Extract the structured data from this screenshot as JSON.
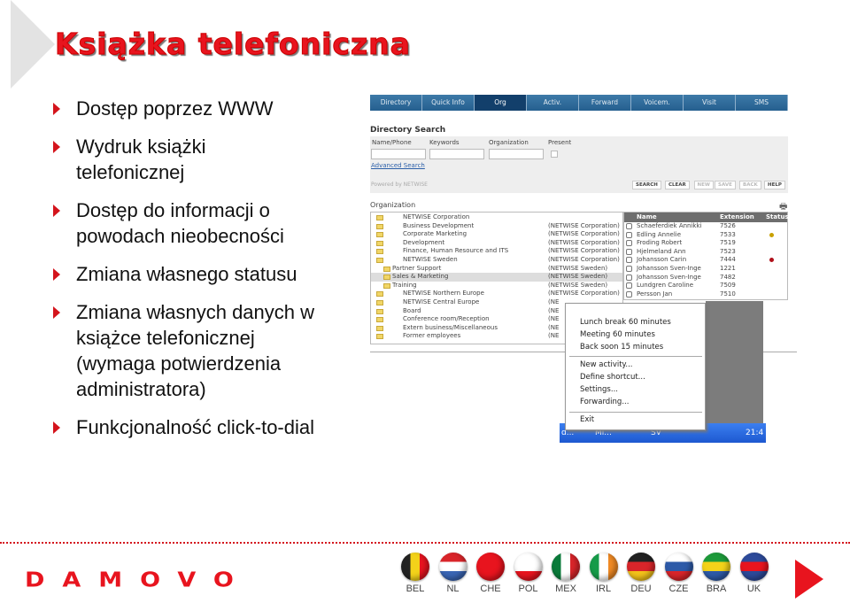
{
  "title": "Książka telefoniczna",
  "bullets": [
    "Dostęp poprzez WWW",
    "Wydruk książki telefonicznej",
    "Dostęp do informacji o powodach nieobecności",
    "Zmiana własnego statusu",
    "Zmiana własnych danych w książce telefonicznej (wymaga potwierdzenia administratora)",
    "Funkcjonalność click-to-dial"
  ],
  "app": {
    "tabs": [
      "Directory",
      "Quick Info",
      "Org",
      "Activ.",
      "Forward",
      "Voicem.",
      "Visit",
      "SMS"
    ],
    "active_tab": "Org",
    "search_title": "Directory Search",
    "fields": [
      "Name/Phone",
      "Keywords",
      "Organization"
    ],
    "present_label": "Present",
    "advanced_link": "Advanced Search",
    "powered": "Powered by NETWISE",
    "buttons": [
      "SEARCH",
      "CLEAR",
      "NEW",
      "SAVE",
      "BACK",
      "HELP"
    ],
    "org_label": "Organization",
    "tree": [
      {
        "name": "NETWISE Corporation",
        "parent": ""
      },
      {
        "name": "Business Development",
        "parent": "(NETWISE Corporation)"
      },
      {
        "name": "Corporate Marketing",
        "parent": "(NETWISE Corporation)"
      },
      {
        "name": "Development",
        "parent": "(NETWISE Corporation)"
      },
      {
        "name": "Finance, Human Resource and ITS",
        "parent": "(NETWISE Corporation)"
      },
      {
        "name": "NETWISE Sweden",
        "parent": "(NETWISE Corporation)"
      },
      {
        "name": "Partner Support",
        "parent": "(NETWISE Sweden)"
      },
      {
        "name": "Sales & Marketing",
        "parent": "(NETWISE Sweden)"
      },
      {
        "name": "Training",
        "parent": "(NETWISE Sweden)"
      },
      {
        "name": "NETWISE Northern Europe",
        "parent": "(NETWISE Corporation)"
      },
      {
        "name": "NETWISE Central Europe",
        "parent": "(NE"
      },
      {
        "name": "Board",
        "parent": "(NE"
      },
      {
        "name": "Conference room/Reception",
        "parent": "(NE"
      },
      {
        "name": "Extern business/Miscellaneous",
        "parent": "(NE"
      },
      {
        "name": "Former employees",
        "parent": "(NE"
      }
    ],
    "people_headers": [
      "Name",
      "Extension",
      "Status"
    ],
    "people": [
      {
        "name": "Schaeferdiek Annikki",
        "ext": "7526",
        "status": ""
      },
      {
        "name": "Edling Annelie",
        "ext": "7533",
        "status": "#c8a000"
      },
      {
        "name": "Froding Robert",
        "ext": "7519",
        "status": ""
      },
      {
        "name": "Hjelmeland Ann",
        "ext": "7523",
        "status": ""
      },
      {
        "name": "Johansson Carin",
        "ext": "7444",
        "status": "#b0101a"
      },
      {
        "name": "Johansson Sven-Inge",
        "ext": "1221",
        "status": ""
      },
      {
        "name": "Johansson Sven-Inge",
        "ext": "7482",
        "status": ""
      },
      {
        "name": "Lundgren Caroline",
        "ext": "7509",
        "status": ""
      },
      {
        "name": "Persson Jan",
        "ext": "7510",
        "status": ""
      }
    ],
    "menu": [
      "Lunch break 60 minutes",
      "Meeting 60 minutes",
      "Back soon 15 minutes",
      "New activity...",
      "Define shortcut...",
      "Settings...",
      "Forwarding...",
      "Exit"
    ],
    "taskbar": {
      "item1": "d...",
      "item2": "Mi...",
      "lang": "SV",
      "clock": "21:4"
    }
  },
  "logo": "DAMOVO",
  "flags": [
    {
      "code": "BEL",
      "colors": [
        "#222",
        "#f3d21a",
        "#e8141e"
      ]
    },
    {
      "code": "NL",
      "colors": [
        "#d9252a",
        "#fff",
        "#3a66b5"
      ]
    },
    {
      "code": "CHE",
      "colors": [
        "#e8141e",
        "#e8141e",
        "#e8141e"
      ]
    },
    {
      "code": "POL",
      "colors": [
        "#fff",
        "#fff",
        "#e8141e"
      ]
    },
    {
      "code": "MEX",
      "colors": [
        "#0a7a3a",
        "#fff",
        "#d9252a"
      ]
    },
    {
      "code": "IRL",
      "colors": [
        "#169b49",
        "#fff",
        "#f08a24"
      ]
    },
    {
      "code": "DEU",
      "colors": [
        "#222",
        "#d9252a",
        "#f3c21a"
      ]
    },
    {
      "code": "CZE",
      "colors": [
        "#fff",
        "#2d5aa8",
        "#d9252a"
      ]
    },
    {
      "code": "BRA",
      "colors": [
        "#1d9a3a",
        "#f3d21a",
        "#2d5aa8"
      ]
    },
    {
      "code": "UK",
      "colors": [
        "#2d4a9a",
        "#e8141e",
        "#2d4a9a"
      ]
    }
  ],
  "accent": "#e8141e"
}
